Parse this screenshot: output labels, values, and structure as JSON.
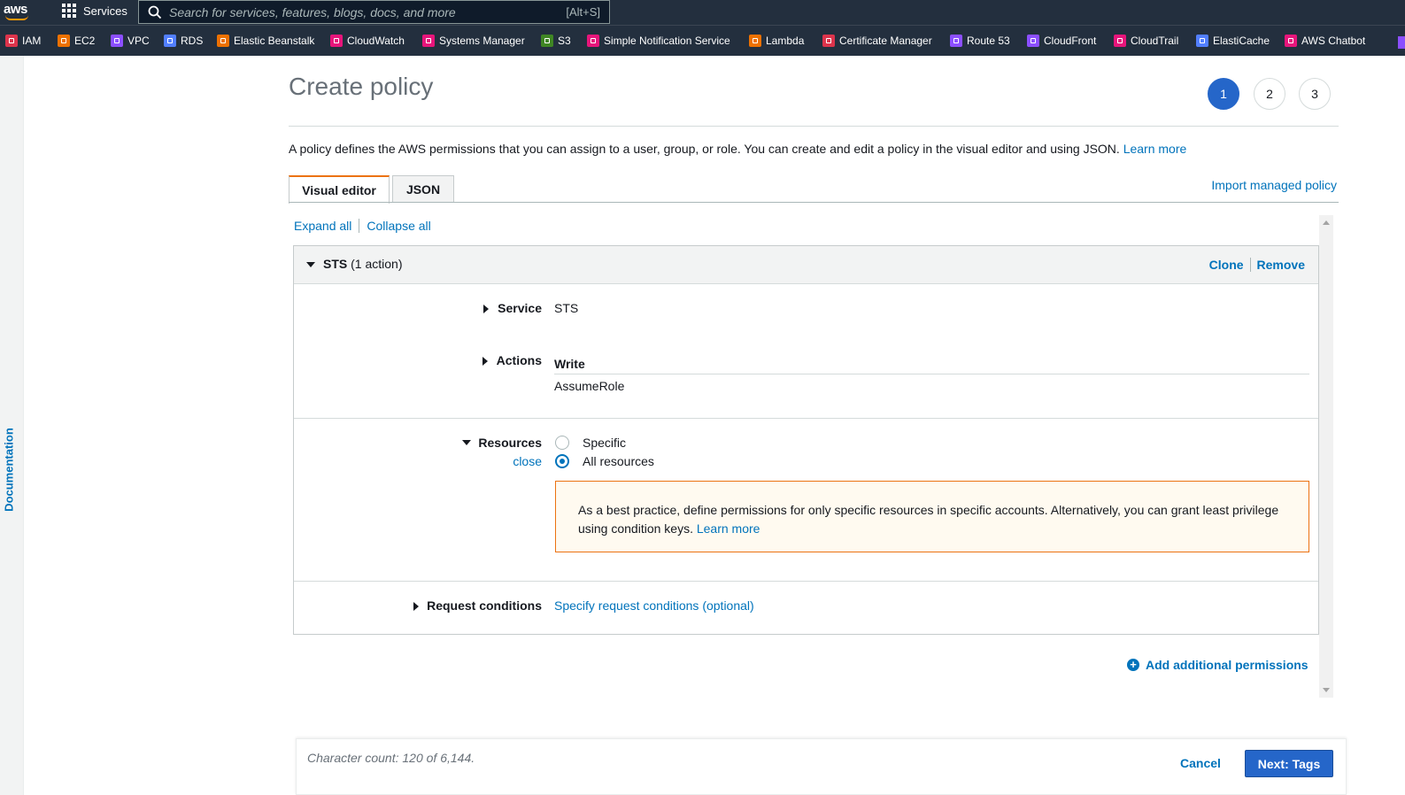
{
  "topnav": {
    "logo": "aws",
    "services_label": "Services",
    "search_placeholder": "Search for services, features, blogs, docs, and more",
    "search_shortcut": "[Alt+S]"
  },
  "favorites": [
    {
      "label": "IAM",
      "color": "#dd344c"
    },
    {
      "label": "EC2",
      "color": "#ed7100"
    },
    {
      "label": "VPC",
      "color": "#8c4fff"
    },
    {
      "label": "RDS",
      "color": "#527fff"
    },
    {
      "label": "Elastic Beanstalk",
      "color": "#ed7100"
    },
    {
      "label": "CloudWatch",
      "color": "#e7157b"
    },
    {
      "label": "Systems Manager",
      "color": "#e7157b"
    },
    {
      "label": "S3",
      "color": "#3f8624"
    },
    {
      "label": "Simple Notification Service",
      "color": "#e7157b"
    },
    {
      "label": "Lambda",
      "color": "#ed7100"
    },
    {
      "label": "Certificate Manager",
      "color": "#dd344c"
    },
    {
      "label": "Route 53",
      "color": "#8c4fff"
    },
    {
      "label": "CloudFront",
      "color": "#8c4fff"
    },
    {
      "label": "CloudTrail",
      "color": "#e7157b"
    },
    {
      "label": "ElastiCache",
      "color": "#527fff"
    },
    {
      "label": "AWS Chatbot",
      "color": "#e7157b"
    }
  ],
  "sidebar": {
    "documentation_label": "Documentation"
  },
  "page": {
    "title": "Create policy",
    "steps": [
      "1",
      "2",
      "3"
    ],
    "active_step": "1",
    "intro_text": "A policy defines the AWS permissions that you can assign to a user, group, or role. You can create and edit a policy in the visual editor and using JSON.",
    "intro_link": "Learn more",
    "tabs": [
      "Visual editor",
      "JSON"
    ],
    "import_link": "Import managed policy",
    "expand_all": "Expand all",
    "collapse_all": "Collapse all"
  },
  "statement": {
    "service_name": "STS",
    "action_count": "(1 action)",
    "clone_label": "Clone",
    "remove_label": "Remove",
    "service_label": "Service",
    "service_value": "STS",
    "actions_label": "Actions",
    "actions_group": "Write",
    "actions_value": "AssumeRole",
    "resources_label": "Resources",
    "resources_close": "close",
    "resource_options": [
      "Specific",
      "All resources"
    ],
    "resource_selected": "All resources",
    "warning_text": "As a best practice, define permissions for only specific resources in specific accounts. Alternatively, you can grant least privilege using condition keys.",
    "warning_link": "Learn more",
    "conditions_label": "Request conditions",
    "conditions_link": "Specify request conditions (optional)"
  },
  "add_permissions_label": "Add additional permissions",
  "footer": {
    "char_count": "Character count: 120 of 6,144.",
    "cancel_label": "Cancel",
    "next_label": "Next: Tags"
  },
  "colors": {
    "nav_bg": "#232f3e",
    "link": "#0073bb",
    "primary": "#2566c9",
    "tab_accent": "#ec7211",
    "warning_border": "#ec7211"
  }
}
